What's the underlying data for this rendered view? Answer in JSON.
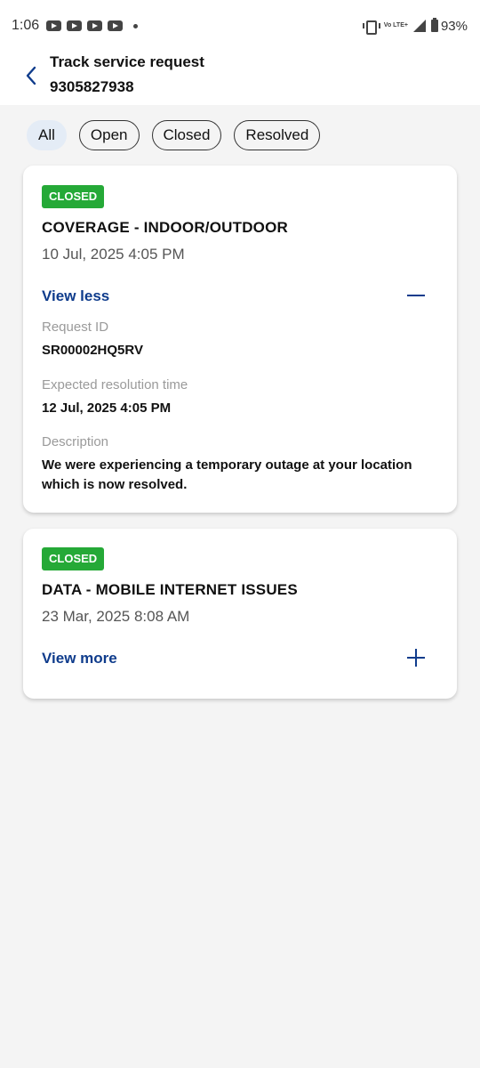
{
  "status_bar": {
    "time": "1:06",
    "network": "Vo LTE+",
    "battery": "93%"
  },
  "header": {
    "title": "Track service request",
    "subtitle": "9305827938"
  },
  "filters": [
    {
      "label": "All",
      "active": true
    },
    {
      "label": "Open",
      "active": false
    },
    {
      "label": "Closed",
      "active": false
    },
    {
      "label": "Resolved",
      "active": false
    }
  ],
  "requests": [
    {
      "status": "CLOSED",
      "title": "COVERAGE - INDOOR/OUTDOOR",
      "date": "10 Jul, 2025  4:05 PM",
      "toggle_label": "View less",
      "request_id_label": "Request ID",
      "request_id": "SR00002HQ5RV",
      "resolution_label": "Expected resolution time",
      "resolution_time": "12 Jul, 2025  4:05 PM",
      "description_label": "Description",
      "description": "We were experiencing a temporary outage at your location which is now resolved."
    },
    {
      "status": "CLOSED",
      "title": "DATA - MOBILE INTERNET ISSUES",
      "date": "23 Mar, 2025  8:08 AM",
      "toggle_label": "View more"
    }
  ],
  "colors": {
    "badge": "#25a937",
    "link": "#0f3c8c",
    "background": "#f4f4f4",
    "active_chip": "#e4ecf6"
  }
}
